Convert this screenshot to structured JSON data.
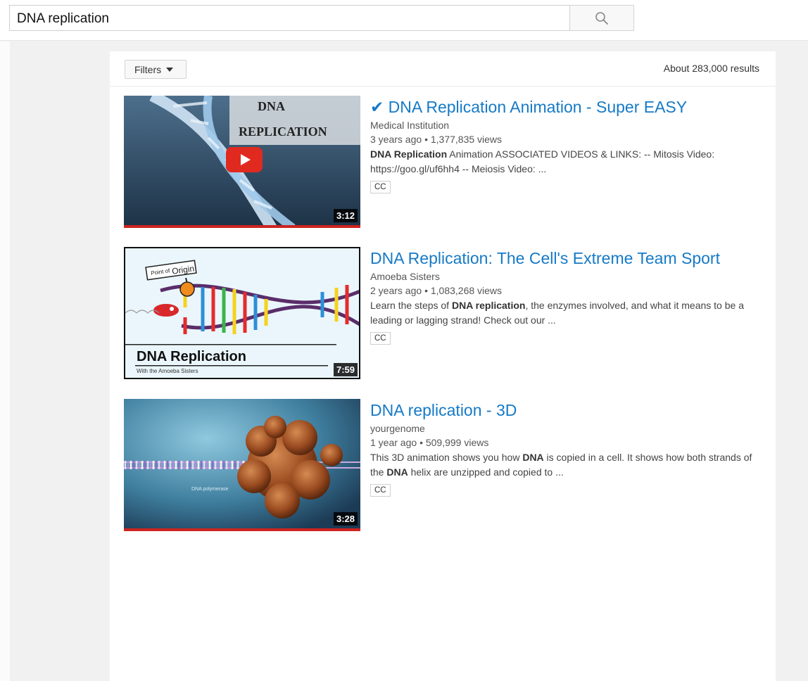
{
  "search": {
    "query": "DNA replication"
  },
  "filters": {
    "label": "Filters",
    "result_count": "About 283,000 results"
  },
  "results": [
    {
      "title_mark": "✔",
      "title": "DNA Replication Animation - Super EASY",
      "channel": "Medical Institution",
      "age": "3 years ago",
      "views": "1,377,835 views",
      "desc_bold": "DNA Replication",
      "desc_rest": " Animation ASSOCIATED VIDEOS & LINKS: -- Mitosis Video: https://goo.gl/uf6hh4 -- Meiosis Video: ...",
      "cc": "CC",
      "duration": "3:12",
      "thumb_text_1": "DNA",
      "thumb_text_2": "REPLICATION"
    },
    {
      "title": "DNA Replication: The Cell's Extreme Team Sport",
      "channel": "Amoeba Sisters",
      "age": "2 years ago",
      "views": "1,083,268 views",
      "desc_1": "Learn the steps of ",
      "desc_bold": "DNA replication",
      "desc_2": ", the enzymes involved, and what it means to be a leading or lagging strand! Check out our ...",
      "cc": "CC",
      "duration": "7:59",
      "thumb_sign_small": "Point of",
      "thumb_sign_big": "Origin",
      "thumb_caption": "DNA Replication",
      "thumb_subcaption": "With the Amoeba Sisters"
    },
    {
      "title": "DNA replication - 3D",
      "channel": "yourgenome",
      "age": "1 year ago",
      "views": "509,999 views",
      "desc_1": "This 3D animation shows you how ",
      "desc_bold_1": "DNA",
      "desc_2": " is copied in a cell. It shows how both strands of the ",
      "desc_bold_2": "DNA",
      "desc_3": " helix are unzipped and copied to ...",
      "cc": "CC",
      "duration": "3:28",
      "thumb_label": "DNA polymerase"
    }
  ],
  "separator": "•"
}
